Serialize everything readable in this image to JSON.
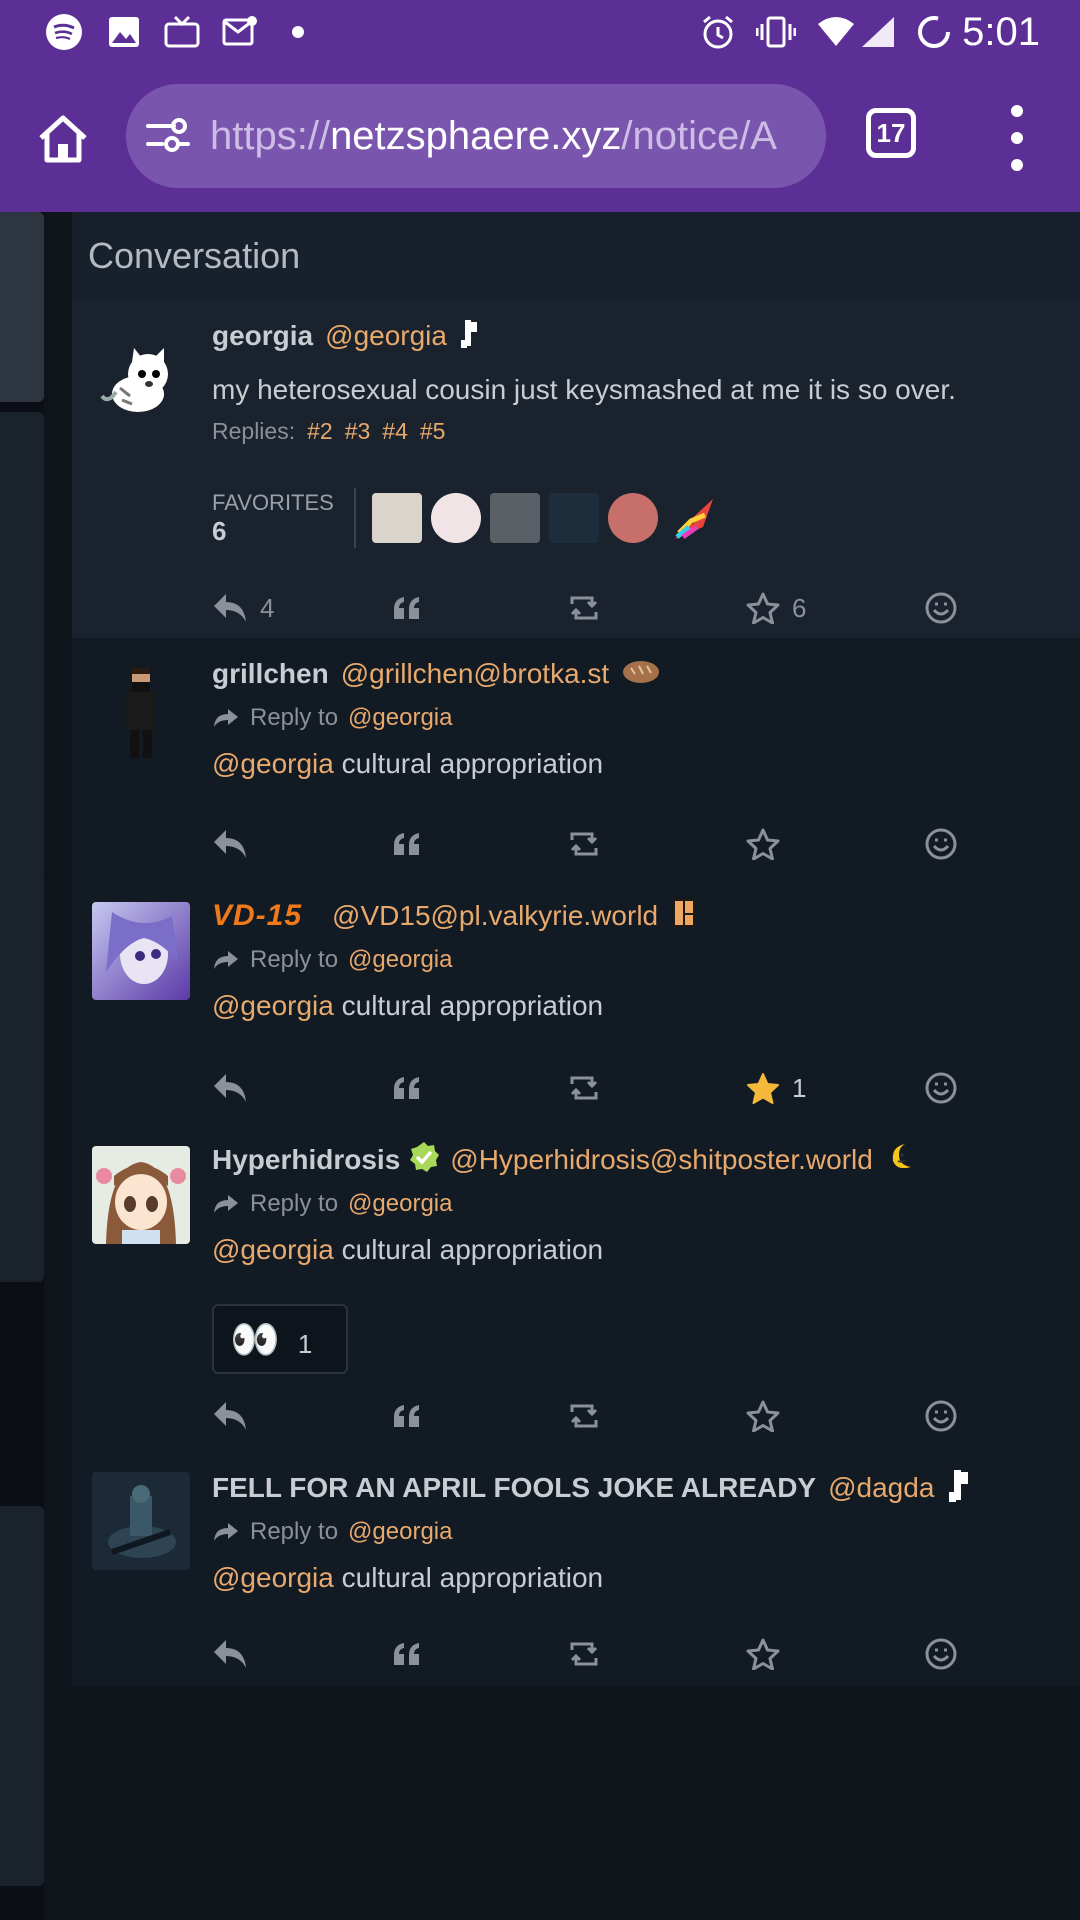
{
  "statusbar": {
    "time": "5:01",
    "left_icons": [
      "spotify-icon",
      "image-icon",
      "tv-icon",
      "mail-icon",
      "dot-icon"
    ],
    "right_icons": [
      "alarm-icon",
      "vibrate-icon",
      "wifi-icon",
      "signal-icon",
      "battery-icon"
    ]
  },
  "browser": {
    "url_dim_prefix": "https://",
    "url_host": "netzsphaere.xyz",
    "url_dim_suffix": "/notice/A",
    "tab_count": "17"
  },
  "panel": {
    "title": "Conversation"
  },
  "colors": {
    "accent": "#e8a96c",
    "toolbar": "#5b2f95",
    "panel": "#121a24",
    "highlight": "#1a222d",
    "star": "#f5b83a"
  },
  "posts": [
    {
      "name": "georgia",
      "handle": "@georgia",
      "text": "my heterosexual cousin just keysmashed at me it is so over.",
      "replies_label": "Replies:",
      "replies": [
        "#2",
        "#3",
        "#4",
        "#5"
      ],
      "favorites_label": "FAVORITES",
      "favorites_count": "6",
      "reply_count": "4",
      "fav_action_count": "6"
    },
    {
      "name": "grillchen",
      "handle": "@grillchen@brotka.st",
      "reply_label": "Reply to",
      "reply_user": "@georgia",
      "mention": "@georgia",
      "text": " cultural appropriation"
    },
    {
      "name": "VD-15",
      "handle": "@VD15@pl.valkyrie.world",
      "reply_label": "Reply to",
      "reply_user": "@georgia",
      "mention": "@georgia",
      "text": " cultural appropriation",
      "fav_action_count": "1"
    },
    {
      "name": "Hyperhidrosis",
      "handle": "@Hyperhidrosis@shitposter.world",
      "reply_label": "Reply to",
      "reply_user": "@georgia",
      "mention": "@georgia",
      "text": " cultural appropriation",
      "reaction_emoji": "👀",
      "reaction_count": "1"
    },
    {
      "name": "FELL FOR AN APRIL FOOLS JOKE ALREADY",
      "handle": "@dagda",
      "reply_label": "Reply to",
      "reply_user": "@georgia",
      "mention": "@georgia",
      "text": " cultural appropriation"
    }
  ]
}
